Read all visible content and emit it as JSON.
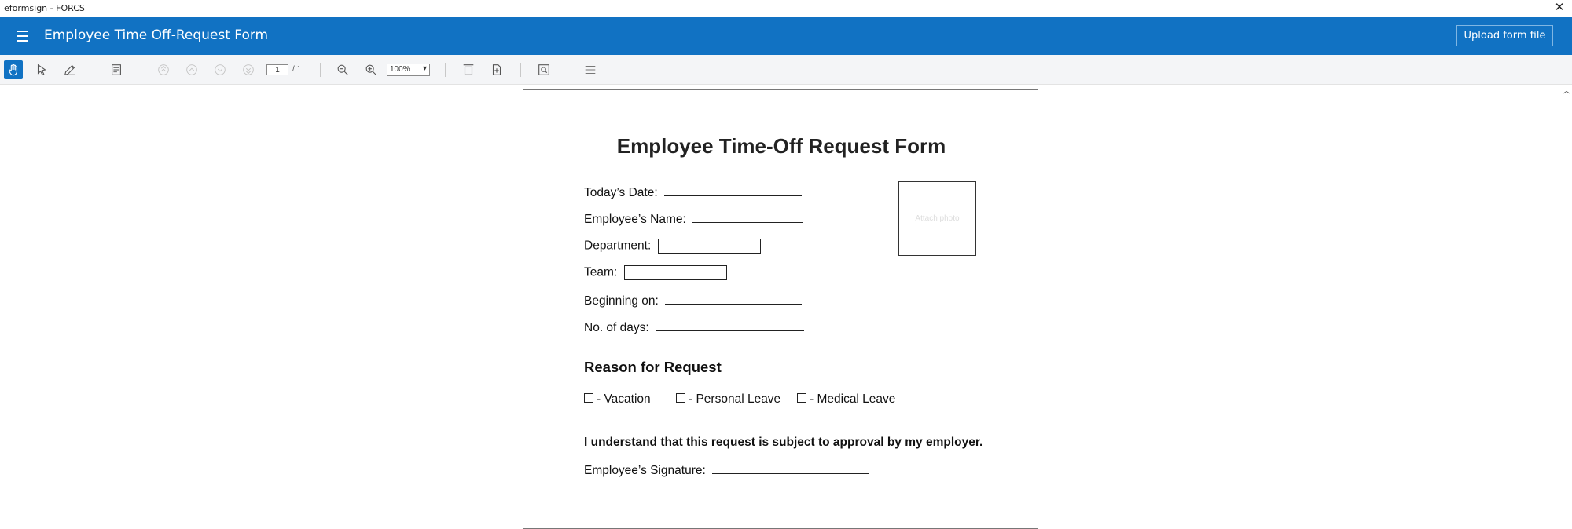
{
  "window": {
    "title": "eformsign - FORCS",
    "close_glyph": "✕"
  },
  "appbar": {
    "title": "Employee Time Off-Request Form",
    "upload_label": "Upload form file"
  },
  "toolbar": {
    "page_current": "1",
    "page_total": "/ 1",
    "zoom": "100%",
    "icons": [
      "hand-tool-icon",
      "select-arrow-icon",
      "pen-edit-icon",
      "form-fields-icon",
      "first-page-icon",
      "prev-page-icon",
      "next-page-icon",
      "last-page-icon",
      "zoom-out-icon",
      "zoom-in-icon",
      "fit-page-icon",
      "add-page-icon",
      "find-icon",
      "more-menu-icon"
    ]
  },
  "document": {
    "title": "Employee Time-Off Request Form",
    "fields": {
      "today_date": "Today’s Date:",
      "employee_name": "Employee’s Name:",
      "department": "Department:",
      "team": "Team:",
      "beginning_on": "Beginning on:",
      "no_of_days": "No. of days:"
    },
    "photo_placeholder": "Attach photo",
    "reason_heading": "Reason for Request",
    "options": [
      "- Vacation",
      "- Personal Leave",
      "- Medical Leave"
    ],
    "acknowledgement": "I understand that this request is subject to approval by my employer.",
    "signature_label": "Employee’s Signature:"
  },
  "colors": {
    "brand_blue": "#1172c3",
    "toolbar_bg": "#f4f5f7"
  }
}
